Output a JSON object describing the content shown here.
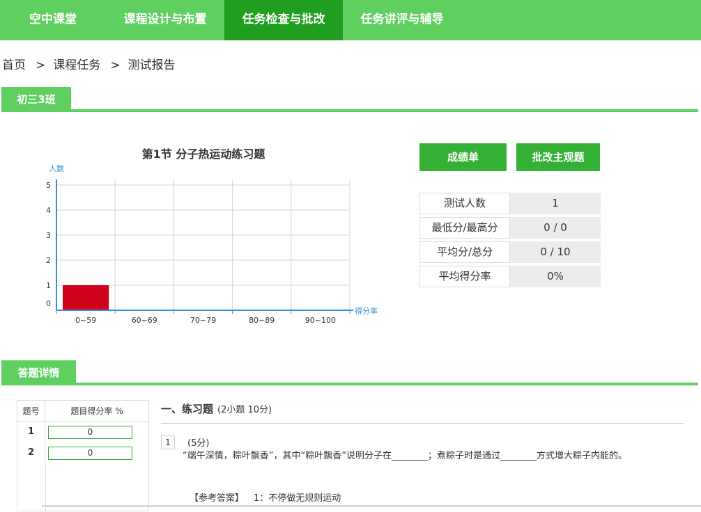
{
  "nav": {
    "items": [
      "空中课堂",
      "课程设计与布置",
      "任务检查与批改",
      "任务讲评与辅导"
    ],
    "active_index": 2
  },
  "breadcrumb": [
    "首页",
    "课程任务",
    "测试报告"
  ],
  "breadcrumb_sep": ">",
  "class_tab": "初三3班",
  "chart_data": {
    "type": "bar",
    "title": "第1节 分子热运动练习题",
    "ylabel": "人数",
    "xlabel": "得分率",
    "categories": [
      "0~59",
      "60~69",
      "70~79",
      "80~89",
      "90~100"
    ],
    "values": [
      1,
      0,
      0,
      0,
      0
    ],
    "yticks": [
      0,
      1,
      2,
      3,
      4,
      5
    ],
    "ylim": [
      0,
      5
    ],
    "bar_color": "#d0021b",
    "axis_color": "#3a8fd0",
    "grid": true
  },
  "buttons": {
    "grades": "成绩单",
    "grade_subjective": "批改主观题"
  },
  "stats": [
    {
      "label": "测试人数",
      "value": "1"
    },
    {
      "label": "最低分/最高分",
      "value": "0 / 0"
    },
    {
      "label": "平均分/总分",
      "value": "0 / 10"
    },
    {
      "label": "平均得分率",
      "value": "0%"
    }
  ],
  "details_tab": "答题详情",
  "answer_table": {
    "headers": [
      "题号",
      "题目得分率 %"
    ],
    "rows": [
      {
        "no": "1",
        "rate": "0"
      },
      {
        "no": "2",
        "rate": "0"
      }
    ]
  },
  "question_section": {
    "title": "一、练习题",
    "subtitle": "(2小题 10分)"
  },
  "question": {
    "number": "1",
    "score": "(5分)",
    "text": "“端午深情，粽叶飘香”，其中“粽叶飘香”说明分子在________；煮粽子时是通过________方式增大粽子内能的。",
    "answer_label": "【参考答案】",
    "answer": "1：不停做无规则运动"
  },
  "colors": {
    "nav_bg": "#5fcf5f",
    "nav_active": "#1f9e1f",
    "button": "#34b034"
  }
}
